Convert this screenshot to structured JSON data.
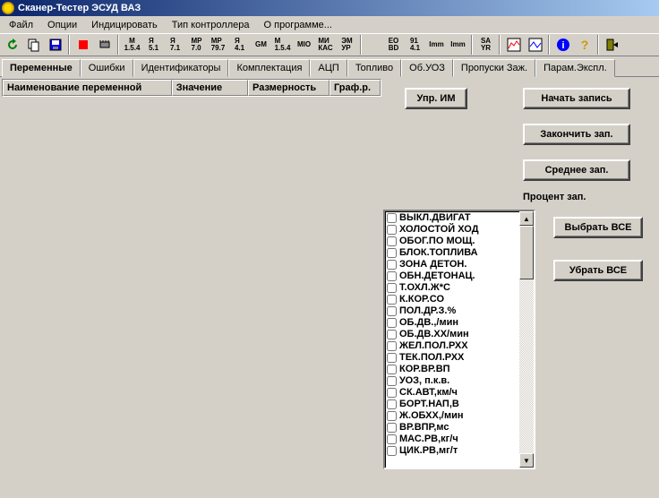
{
  "title": "Сканер-Тестер ЭСУД ВАЗ",
  "menu": {
    "file": "Файл",
    "options": "Опции",
    "indicate": "Индицировать",
    "ctrlType": "Тип контроллера",
    "about": "О программе..."
  },
  "tabs": {
    "vars": "Переменные",
    "err": "Ошибки",
    "ids": "Идентификаторы",
    "comp": "Комплектация",
    "acp": "АЦП",
    "fuel": "Топливо",
    "obuz": "Об.УОЗ",
    "miss": "Пропуски Заж.",
    "param": "Парам.Экспл."
  },
  "cols": {
    "name": "Наименование переменной",
    "val": "Значение",
    "dim": "Размерность",
    "graph": "Граф.р."
  },
  "buttons": {
    "uprIM": "Упр. ИМ",
    "startRec": "Начать запись",
    "endRec": "Закончить зап.",
    "avgRec": "Среднее зап.",
    "selectAll": "Выбрать ВСЕ",
    "deselectAll": "Убрать ВСЕ"
  },
  "labels": {
    "percentRec": "Процент зап."
  },
  "checklist": [
    "ВЫКЛ.ДВИГАТ",
    "ХОЛОСТОЙ ХОД",
    "ОБОГ.ПО МОЩ.",
    "БЛОК.ТОПЛИВА",
    "ЗОНА ДЕТОН.",
    "ОБН.ДЕТОНАЦ.",
    "Т.ОХЛ.Ж*С",
    "К.КОР.СО",
    "ПОЛ.ДР.З.%",
    "ОБ.ДВ.,/мин",
    "ОБ.ДВ.ХХ/мин",
    "ЖЕЛ.ПОЛ.РХХ",
    "ТЕК.ПОЛ.РХХ",
    "КОР.ВР.ВП",
    "УОЗ, п.к.в.",
    "СК.АВТ,км/ч",
    "БОРТ.НАП,В",
    "Ж.ОБХХ,/мин",
    "ВР.ВПР,мс",
    "МАС.РВ,кг/ч",
    "ЦИК.РВ,мг/т"
  ]
}
